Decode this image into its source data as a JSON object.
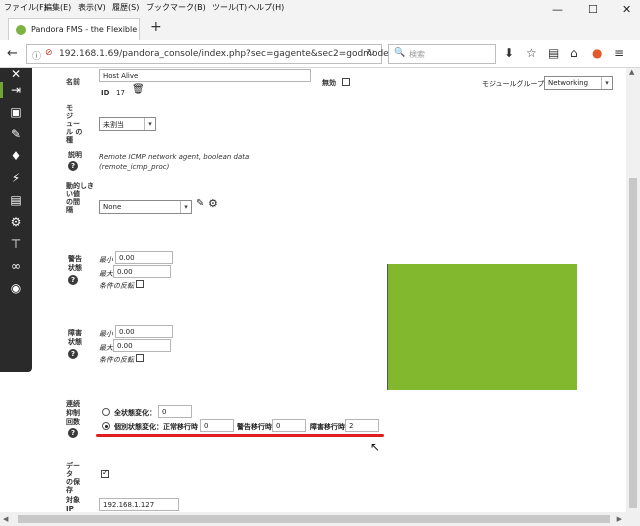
{
  "menu": [
    "ファイル(F)",
    "編集(E)",
    "表示(V)",
    "履歴(S)",
    "ブックマーク(B)",
    "ツール(T)",
    "ヘルプ(H)"
  ],
  "window_controls": {
    "minimize": "—",
    "maximize": "☐",
    "close": "✕"
  },
  "tab": {
    "title": "Pandora FMS - the Flexible M",
    "close": "✕",
    "new_tab": "+"
  },
  "nav": {
    "url": "192.168.1.69/pandora_console/index.php?sec=gagente&sec2=godmode/",
    "search_placeholder": "検索"
  },
  "sidebar_icons": [
    "✕",
    "⇥",
    "▣",
    "✎",
    "♦",
    "⚡",
    "▤",
    "⚙",
    "⊤",
    "∞",
    "◉"
  ],
  "form": {
    "name_label": "名前",
    "name_value": "Host Alive",
    "id_label": "ID",
    "id_value": "17",
    "disabled_label": "無効",
    "module_group_label": "モジュールグループ",
    "module_group_value": "Networking",
    "module_type_label": [
      "モ",
      "ジ",
      "ュー",
      "ル の",
      "種"
    ],
    "module_type_value": "未割当",
    "description_label": "説明",
    "description_line1": "Remote ICMP network agent, boolean data",
    "description_line2": "(remote_icmp_proc)",
    "dynamic_threshold_label": [
      "動的しき",
      "い値",
      "の間",
      "隔"
    ],
    "dynamic_threshold_value": "None",
    "warning_label": [
      "警告",
      "状態"
    ],
    "warning_min_label": "最小",
    "warning_min_value": "0.00",
    "warning_max_label": "最大",
    "warning_max_value": "0.00",
    "warning_invert_label": "条件の反転",
    "critical_label": [
      "障害",
      "状態"
    ],
    "critical_min_label": "最小",
    "critical_min_value": "0.00",
    "critical_max_label": "最大",
    "critical_max_value": "0.00",
    "critical_invert_label": "条件の反転",
    "ff_label": [
      "連続",
      "抑制",
      "回数"
    ],
    "ff_all_label": "全状態変化：",
    "ff_all_value": "0",
    "ff_individual_label": "個別状態変化：正常移行時",
    "ff_normal_value": "0",
    "ff_warning_label": "警告移行時",
    "ff_warning_value": "0",
    "ff_critical_label": "障害移行時",
    "ff_critical_value": "2",
    "historical_label": [
      "デー",
      "タ",
      "の保",
      "存"
    ],
    "target_label": [
      "対象",
      "IP"
    ],
    "target_value": "192.168.1.127"
  },
  "colors": {
    "accent_green": "#82b82d",
    "sidebar": "#2a2a2a",
    "highlight_red": "#e02020"
  }
}
